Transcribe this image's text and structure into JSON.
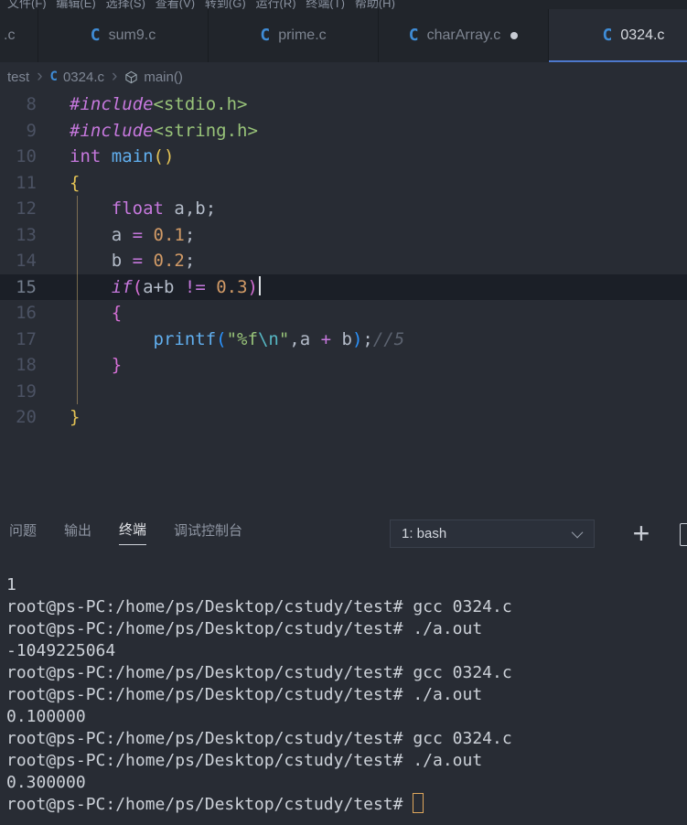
{
  "title_bar": {
    "menu_text": "文件(F)   编辑(E)   选择(S)   查看(V)   转到(G)   运行(R)   终端(T)   帮助(H)"
  },
  "tabs": [
    {
      "id": "clipped",
      "label": ".c",
      "partial": true
    },
    {
      "id": "sum9",
      "label": "sum9.c"
    },
    {
      "id": "prime",
      "label": "prime.c"
    },
    {
      "id": "chararray",
      "label": "charArray.c",
      "modified": true
    },
    {
      "id": "0324",
      "label": "0324.c",
      "active": true
    }
  ],
  "breadcrumb": [
    {
      "label": "test"
    },
    {
      "label": "0324.c",
      "icon": "c-file-icon"
    },
    {
      "label": "main()",
      "icon": "symbol-method-icon"
    }
  ],
  "editor": {
    "current_line": 15,
    "lines": [
      {
        "no": "8",
        "tokens": [
          [
            "kwit",
            "#include"
          ],
          [
            "str",
            "<stdio.h>"
          ]
        ]
      },
      {
        "no": "9",
        "tokens": [
          [
            "kwit",
            "#include"
          ],
          [
            "str",
            "<string.h>"
          ]
        ]
      },
      {
        "no": "10",
        "tokens": [
          [
            "kw",
            "int"
          ],
          [
            "txt",
            " "
          ],
          [
            "fn",
            "main"
          ],
          [
            "b1",
            "()"
          ]
        ]
      },
      {
        "no": "11",
        "tokens": [
          [
            "b1",
            "{"
          ]
        ]
      },
      {
        "no": "12",
        "tokens": [
          [
            "txt",
            "    "
          ],
          [
            "kw",
            "float"
          ],
          [
            "txt",
            " a,b;"
          ]
        ]
      },
      {
        "no": "13",
        "tokens": [
          [
            "txt",
            "    a "
          ],
          [
            "op",
            "="
          ],
          [
            "txt",
            " "
          ],
          [
            "num",
            "0.1"
          ],
          [
            "txt",
            ";"
          ]
        ]
      },
      {
        "no": "14",
        "tokens": [
          [
            "txt",
            "    b "
          ],
          [
            "op",
            "="
          ],
          [
            "txt",
            " "
          ],
          [
            "num",
            "0.2"
          ],
          [
            "txt",
            ";"
          ]
        ]
      },
      {
        "no": "15",
        "tokens": [
          [
            "txt",
            "    "
          ],
          [
            "kwit",
            "if"
          ],
          [
            "b2",
            "("
          ],
          [
            "txt",
            "a+b "
          ],
          [
            "op",
            "!="
          ],
          [
            "txt",
            " "
          ],
          [
            "num",
            "0.3"
          ],
          [
            "b2",
            ")"
          ]
        ],
        "current": true,
        "cursor": true
      },
      {
        "no": "16",
        "tokens": [
          [
            "txt",
            "    "
          ],
          [
            "b2",
            "{"
          ]
        ]
      },
      {
        "no": "17",
        "tokens": [
          [
            "txt",
            "        "
          ],
          [
            "fn",
            "printf"
          ],
          [
            "b3",
            "("
          ],
          [
            "str",
            "\"%f"
          ],
          [
            "esc",
            "\\n"
          ],
          [
            "str",
            "\""
          ],
          [
            "txt",
            ",a "
          ],
          [
            "op",
            "+"
          ],
          [
            "txt",
            " b"
          ],
          [
            "b3",
            ")"
          ],
          [
            "txt",
            ";"
          ],
          [
            "cmt",
            "//5"
          ]
        ]
      },
      {
        "no": "18",
        "tokens": [
          [
            "txt",
            "    "
          ],
          [
            "b2",
            "}"
          ]
        ]
      },
      {
        "no": "19",
        "tokens": []
      },
      {
        "no": "20",
        "tokens": [
          [
            "b1",
            "}"
          ]
        ]
      }
    ]
  },
  "panel": {
    "tabs": [
      {
        "id": "problems",
        "label": "问题"
      },
      {
        "id": "output",
        "label": "输出"
      },
      {
        "id": "terminal",
        "label": "终端",
        "active": true
      },
      {
        "id": "debug-console",
        "label": "调试控制台"
      }
    ],
    "shell_select": "1: bash"
  },
  "terminal": {
    "lines": [
      {
        "t": "1"
      },
      {
        "t": "root@ps-PC:/home/ps/Desktop/cstudy/test# gcc 0324.c"
      },
      {
        "t": "root@ps-PC:/home/ps/Desktop/cstudy/test# ./a.out"
      },
      {
        "t": "-1049225064"
      },
      {
        "t": "root@ps-PC:/home/ps/Desktop/cstudy/test# gcc 0324.c"
      },
      {
        "t": "root@ps-PC:/home/ps/Desktop/cstudy/test# ./a.out"
      },
      {
        "t": "0.100000"
      },
      {
        "t": "root@ps-PC:/home/ps/Desktop/cstudy/test# gcc 0324.c"
      },
      {
        "t": "root@ps-PC:/home/ps/Desktop/cstudy/test# ./a.out"
      },
      {
        "t": "0.300000"
      },
      {
        "t": "root@ps-PC:/home/ps/Desktop/cstudy/test# ",
        "cursor": true
      }
    ]
  },
  "colors": {
    "active_tab_accent": "#4d78cc",
    "keyword": "#c678dd",
    "function": "#61afef",
    "string": "#98c379",
    "number": "#d19a66",
    "comment": "#5c6370",
    "bracket_level1": "#e5c455",
    "bracket_level2": "#d670d6",
    "bracket_level3": "#2b94ff",
    "c_file_icon": "#3f8cd6",
    "terminal_cursor": "#dfa75c"
  }
}
